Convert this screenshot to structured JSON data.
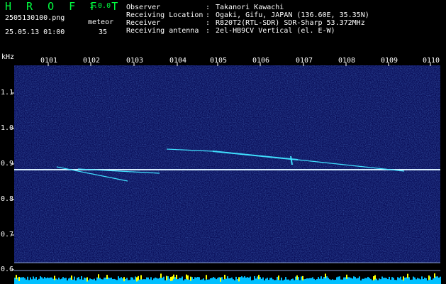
{
  "header": {
    "app_title": "H R O F F T",
    "app_version": "1.0.0",
    "filename": "2505130100.png",
    "datetime": "25.05.13 01:00",
    "meteor_label": "meteor",
    "meteor_count": "35"
  },
  "station_info": [
    {
      "key": "Observer",
      "sep": ":",
      "value": "Takanori Kawachi"
    },
    {
      "key": "Receiving Location",
      "sep": ":",
      "value": "Ogaki, Gifu, JAPAN (136.60E, 35.35N)"
    },
    {
      "key": "Receiver",
      "sep": ":",
      "value": "R820T2(RTL-SDR) SDR-Sharp 53.372MHz"
    },
    {
      "key": "Receiving antenna",
      "sep": ":",
      "value": "2el-HB9CV Vertical (el. E-W)"
    }
  ],
  "axis": {
    "unit": "kHz",
    "frequency_ticks": [
      "1.1",
      "1.0",
      "0.9",
      "0.8",
      "0.7",
      "0.6"
    ],
    "time_ticks": [
      "0101",
      "0102",
      "0103",
      "0104",
      "0105",
      "0106",
      "0107",
      "0108",
      "0109",
      "0110"
    ]
  },
  "colors": {
    "title_green": "#00ff40",
    "background_noise": "#0a0f5a",
    "carrier_line": "#d8f0ff",
    "meteor_trace": "#40e0ff",
    "level_bars": "#00c0ff",
    "level_peaks": "#ffff00"
  }
}
